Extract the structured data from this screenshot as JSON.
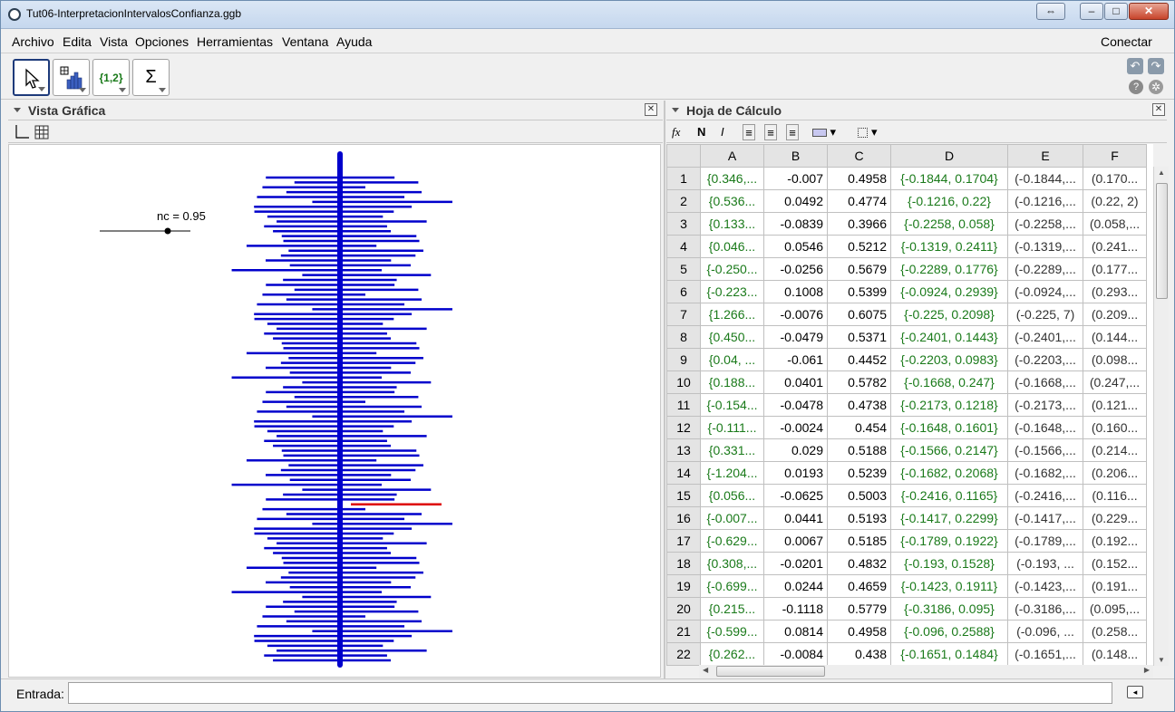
{
  "window": {
    "title": "Tut06-InterpretacionIntervalosConfianza.ggb"
  },
  "menu": {
    "items": [
      "Archivo",
      "Edita",
      "Vista",
      "Opciones",
      "Herramientas",
      "Ventana",
      "Ayuda"
    ],
    "connect": "Conectar"
  },
  "toolbar": {
    "list_tool": "{1,2}",
    "sum_tool": "Σ"
  },
  "graphics_view": {
    "title": "Vista Gráfica",
    "slider_label": "nc = 0.95",
    "slider_value": 0.95,
    "colors": {
      "interval": "#0000cc",
      "axis_line": "#0000cc",
      "highlight": "#dd0000"
    }
  },
  "spreadsheet": {
    "title": "Hoja de Cálculo",
    "format_bold": "N",
    "format_italic": "I",
    "fx": "fx",
    "columns": [
      "A",
      "B",
      "C",
      "D",
      "E",
      "F"
    ],
    "rows": [
      {
        "n": "1",
        "A": "{0.346,...",
        "B": "-0.007",
        "C": "0.4958",
        "D": "{-0.1844, 0.1704}",
        "E": "(-0.1844,...",
        "F": "(0.170..."
      },
      {
        "n": "2",
        "A": "{0.536...",
        "B": "0.0492",
        "C": "0.4774",
        "D": "{-0.1216, 0.22}",
        "E": "(-0.1216,...",
        "F": "(0.22, 2)"
      },
      {
        "n": "3",
        "A": "{0.133...",
        "B": "-0.0839",
        "C": "0.3966",
        "D": "{-0.2258, 0.058}",
        "E": "(-0.2258,...",
        "F": "(0.058,..."
      },
      {
        "n": "4",
        "A": "{0.046...",
        "B": "0.0546",
        "C": "0.5212",
        "D": "{-0.1319, 0.2411}",
        "E": "(-0.1319,...",
        "F": "(0.241..."
      },
      {
        "n": "5",
        "A": "{-0.250...",
        "B": "-0.0256",
        "C": "0.5679",
        "D": "{-0.2289, 0.1776}",
        "E": "(-0.2289,...",
        "F": "(0.177..."
      },
      {
        "n": "6",
        "A": "{-0.223...",
        "B": "0.1008",
        "C": "0.5399",
        "D": "{-0.0924, 0.2939}",
        "E": "(-0.0924,...",
        "F": "(0.293..."
      },
      {
        "n": "7",
        "A": "{1.266...",
        "B": "-0.0076",
        "C": "0.6075",
        "D": "{-0.225, 0.2098}",
        "E": "(-0.225, 7)",
        "F": "(0.209..."
      },
      {
        "n": "8",
        "A": "{0.450...",
        "B": "-0.0479",
        "C": "0.5371",
        "D": "{-0.2401, 0.1443}",
        "E": "(-0.2401,...",
        "F": "(0.144..."
      },
      {
        "n": "9",
        "A": "{0.04, ...",
        "B": "-0.061",
        "C": "0.4452",
        "D": "{-0.2203, 0.0983}",
        "E": "(-0.2203,...",
        "F": "(0.098..."
      },
      {
        "n": "10",
        "A": "{0.188...",
        "B": "0.0401",
        "C": "0.5782",
        "D": "{-0.1668, 0.247}",
        "E": "(-0.1668,...",
        "F": "(0.247,..."
      },
      {
        "n": "11",
        "A": "{-0.154...",
        "B": "-0.0478",
        "C": "0.4738",
        "D": "{-0.2173, 0.1218}",
        "E": "(-0.2173,...",
        "F": "(0.121..."
      },
      {
        "n": "12",
        "A": "{-0.111...",
        "B": "-0.0024",
        "C": "0.454",
        "D": "{-0.1648, 0.1601}",
        "E": "(-0.1648,...",
        "F": "(0.160..."
      },
      {
        "n": "13",
        "A": "{0.331...",
        "B": "0.029",
        "C": "0.5188",
        "D": "{-0.1566, 0.2147}",
        "E": "(-0.1566,...",
        "F": "(0.214..."
      },
      {
        "n": "14",
        "A": "{-1.204...",
        "B": "0.0193",
        "C": "0.5239",
        "D": "{-0.1682, 0.2068}",
        "E": "(-0.1682,...",
        "F": "(0.206..."
      },
      {
        "n": "15",
        "A": "{0.056...",
        "B": "-0.0625",
        "C": "0.5003",
        "D": "{-0.2416, 0.1165}",
        "E": "(-0.2416,...",
        "F": "(0.116..."
      },
      {
        "n": "16",
        "A": "{-0.007...",
        "B": "0.0441",
        "C": "0.5193",
        "D": "{-0.1417, 0.2299}",
        "E": "(-0.1417,...",
        "F": "(0.229..."
      },
      {
        "n": "17",
        "A": "{-0.629...",
        "B": "0.0067",
        "C": "0.5185",
        "D": "{-0.1789, 0.1922}",
        "E": "(-0.1789,...",
        "F": "(0.192..."
      },
      {
        "n": "18",
        "A": "{0.308,...",
        "B": "-0.0201",
        "C": "0.4832",
        "D": "{-0.193, 0.1528}",
        "E": "(-0.193, ...",
        "F": "(0.152..."
      },
      {
        "n": "19",
        "A": "{-0.699...",
        "B": "0.0244",
        "C": "0.4659",
        "D": "{-0.1423, 0.1911}",
        "E": "(-0.1423,...",
        "F": "(0.191..."
      },
      {
        "n": "20",
        "A": "{0.215...",
        "B": "-0.1118",
        "C": "0.5779",
        "D": "{-0.3186, 0.095}",
        "E": "(-0.3186,...",
        "F": "(0.095,..."
      },
      {
        "n": "21",
        "A": "{-0.599...",
        "B": "0.0814",
        "C": "0.4958",
        "D": "{-0.096, 0.2588}",
        "E": "(-0.096, ...",
        "F": "(0.258..."
      },
      {
        "n": "22",
        "A": "{0.262...",
        "B": "-0.0084",
        "C": "0.438",
        "D": "{-0.1651, 0.1484}",
        "E": "(-0.1651,...",
        "F": "(0.148..."
      }
    ]
  },
  "input_bar": {
    "label": "Entrada:",
    "value": ""
  }
}
